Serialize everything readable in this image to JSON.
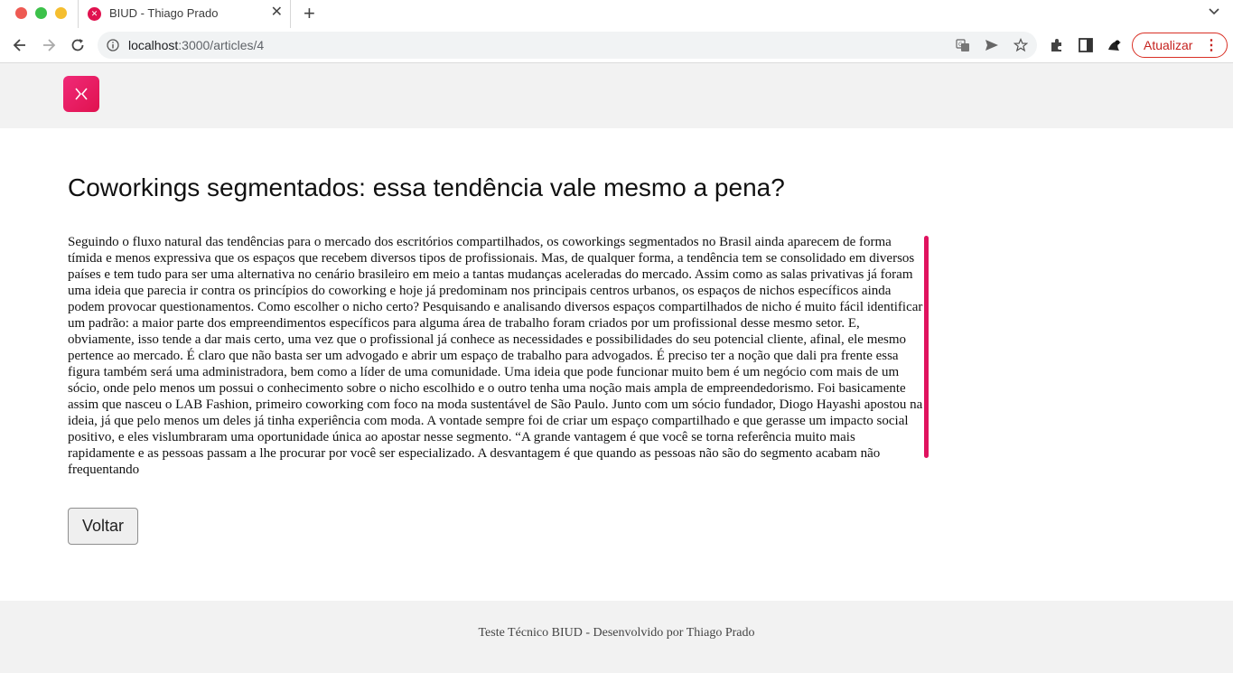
{
  "browser": {
    "tab": {
      "title": "BIUD - Thiago Prado",
      "favicon": "biud-favicon"
    },
    "address": {
      "host": "localhost",
      "path": ":3000/articles/4"
    },
    "update_button": "Atualizar"
  },
  "colors": {
    "brand": "#e0124f",
    "scrollbar": "#e0125f",
    "update": "#c5221f"
  },
  "article": {
    "title": "Coworkings segmentados: essa tendência vale mesmo a pena?",
    "body": "Seguindo o fluxo natural das tendências para o mercado dos escritórios compartilhados, os coworkings segmentados no Brasil ainda aparecem de forma tímida e menos expressiva que os espaços que recebem diversos tipos de profissionais. Mas, de qualquer forma, a tendência tem se consolidado em diversos países e tem tudo para ser uma alternativa no cenário brasileiro em meio a tantas mudanças aceleradas do mercado. Assim como as salas privativas já foram uma ideia que parecia ir contra os princípios do coworking e hoje já predominam nos principais centros urbanos, os espaços de nichos específicos ainda podem provocar questionamentos. Como escolher o nicho certo? Pesquisando e analisando diversos espaços compartilhados de nicho é muito fácil identificar um padrão: a maior parte dos empreendimentos específicos para alguma área de trabalho foram criados por um profissional desse mesmo setor. E, obviamente, isso tende a dar mais certo, uma vez que o profissional já conhece as necessidades e possibilidades do seu potencial cliente, afinal, ele mesmo pertence ao mercado. É claro que não basta ser um advogado e abrir um espaço de trabalho para advogados. É preciso ter a noção que dali pra frente essa figura também será uma administradora, bem como a líder de uma comunidade. Uma ideia que pode funcionar muito bem é um negócio com mais de um sócio, onde pelo menos um possui o conhecimento sobre o nicho escolhido e o outro tenha uma noção mais ampla de empreendedorismo. Foi basicamente assim que nasceu o LAB Fashion, primeiro coworking com foco na moda sustentável de São Paulo. Junto com um sócio fundador, Diogo Hayashi apostou na ideia, já que pelo menos um deles já tinha experiência com moda. A vontade sempre foi de criar um espaço compartilhado e que gerasse um impacto social positivo, e eles vislumbraram uma oportunidade única ao apostar nesse segmento. “A grande vantagem é que você se torna referência muito mais rapidamente e as pessoas passam a lhe procurar por você ser especializado. A desvantagem é que quando as pessoas não são do segmento acabam não frequentando"
  },
  "back_button": "Voltar",
  "footer": {
    "text": "Teste Técnico BIUD - Desenvolvido por Thiago Prado"
  }
}
